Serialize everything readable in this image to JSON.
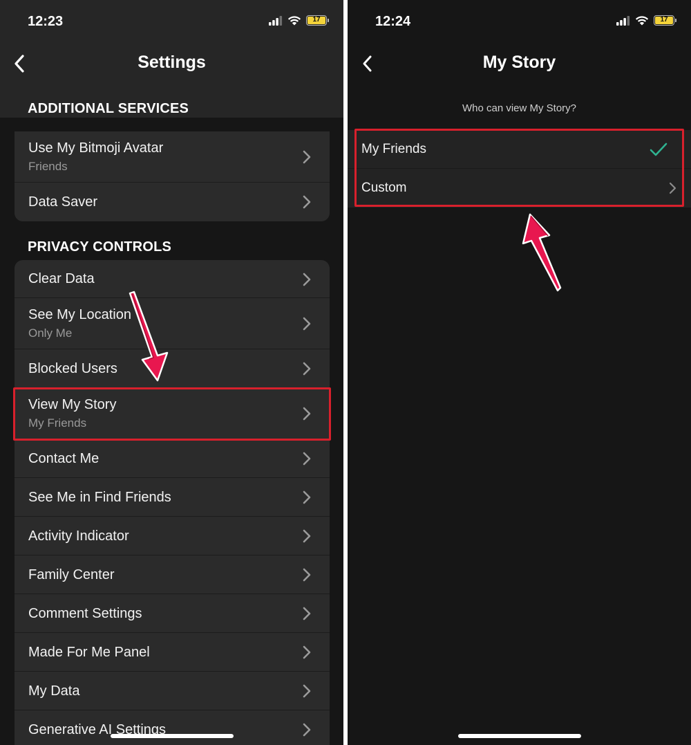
{
  "left_screen": {
    "status": {
      "time": "12:23",
      "battery": "17"
    },
    "title": "Settings",
    "sections": [
      {
        "header": "ADDITIONAL SERVICES",
        "items": [
          {
            "label": "Use My Bitmoji Avatar",
            "sub": "Friends"
          },
          {
            "label": "Data Saver"
          }
        ]
      },
      {
        "header": "PRIVACY CONTROLS",
        "items": [
          {
            "label": "Clear Data"
          },
          {
            "label": "See My Location",
            "sub": "Only Me"
          },
          {
            "label": "Blocked Users"
          },
          {
            "label": "View My Story",
            "sub": "My Friends"
          },
          {
            "label": "Contact Me"
          },
          {
            "label": "See Me in Find Friends"
          },
          {
            "label": "Activity Indicator"
          },
          {
            "label": "Family Center"
          },
          {
            "label": "Comment Settings"
          },
          {
            "label": "Made For Me Panel"
          },
          {
            "label": "My Data"
          },
          {
            "label": "Generative AI Settings"
          }
        ]
      }
    ]
  },
  "right_screen": {
    "status": {
      "time": "12:24",
      "battery": "17"
    },
    "title": "My Story",
    "prompt": "Who can view My Story?",
    "options": [
      {
        "label": "My Friends",
        "selected": true
      },
      {
        "label": "Custom"
      }
    ]
  },
  "colors": {
    "background": "#161616",
    "cell": "#2b2b2b",
    "highlight": "#d8202c",
    "checkmark": "#2fb391",
    "arrow": "#e8174f"
  }
}
